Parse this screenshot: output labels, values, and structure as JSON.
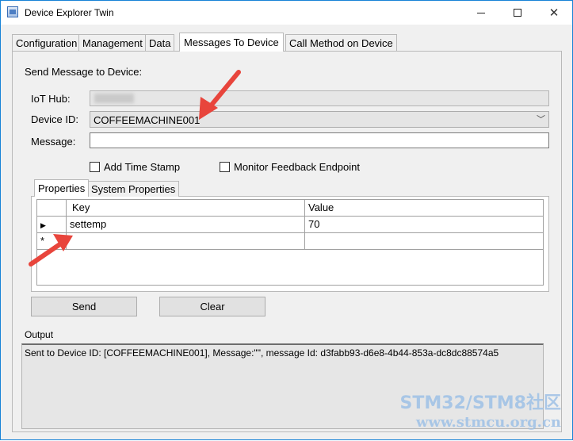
{
  "window": {
    "title": "Device Explorer Twin"
  },
  "tabs": [
    "Configuration",
    "Management",
    "Data",
    "Messages To Device",
    "Call Method on Device"
  ],
  "active_tab": "Messages To Device",
  "form": {
    "heading": "Send Message to Device:",
    "iot_hub_label": "IoT Hub:",
    "iot_hub_value": "",
    "device_id_label": "Device ID:",
    "device_id_value": "COFFEEMACHINE001",
    "message_label": "Message:",
    "message_value": "",
    "add_timestamp_label": "Add Time Stamp",
    "monitor_feedback_label": "Monitor Feedback Endpoint"
  },
  "inner_tabs": [
    "Properties",
    "System Properties"
  ],
  "properties_grid": {
    "columns": [
      "Key",
      "Value"
    ],
    "rows": [
      {
        "key": "settemp",
        "value": "70"
      }
    ],
    "new_row_marker": "*"
  },
  "buttons": {
    "send": "Send",
    "clear": "Clear"
  },
  "output": {
    "label": "Output",
    "text": "Sent to Device ID: [COFFEEMACHINE001], Message:\"\", message Id: d3fabb93-d6e8-4b44-853a-dc8dc88574a5"
  },
  "watermark": {
    "line1": "STM32/STM8社区",
    "line2": "www.stmcu.org.cn"
  },
  "colors": {
    "window_border": "#1883d7",
    "annotation_arrow": "#e8453c",
    "watermark": "#9ec1e6"
  }
}
